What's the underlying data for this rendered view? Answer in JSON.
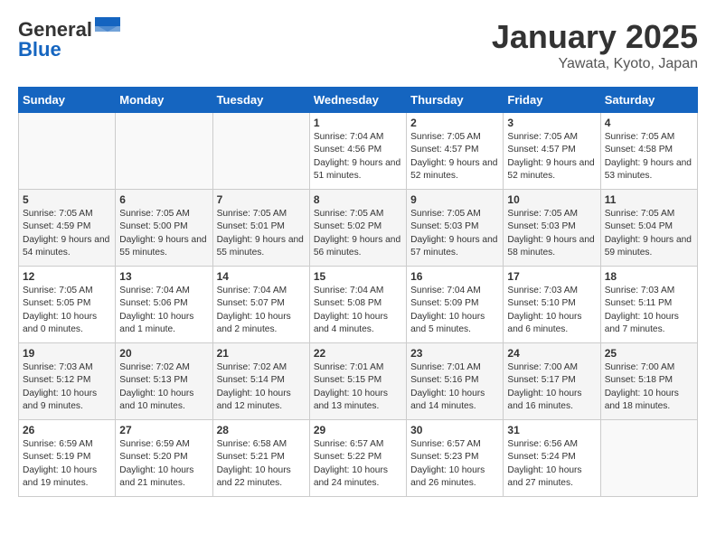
{
  "header": {
    "logo_general": "General",
    "logo_blue": "Blue",
    "month_year": "January 2025",
    "location": "Yawata, Kyoto, Japan"
  },
  "weekdays": [
    "Sunday",
    "Monday",
    "Tuesday",
    "Wednesday",
    "Thursday",
    "Friday",
    "Saturday"
  ],
  "weeks": [
    [
      {
        "day": "",
        "content": ""
      },
      {
        "day": "",
        "content": ""
      },
      {
        "day": "",
        "content": ""
      },
      {
        "day": "1",
        "content": "Sunrise: 7:04 AM\nSunset: 4:56 PM\nDaylight: 9 hours and 51 minutes."
      },
      {
        "day": "2",
        "content": "Sunrise: 7:05 AM\nSunset: 4:57 PM\nDaylight: 9 hours and 52 minutes."
      },
      {
        "day": "3",
        "content": "Sunrise: 7:05 AM\nSunset: 4:57 PM\nDaylight: 9 hours and 52 minutes."
      },
      {
        "day": "4",
        "content": "Sunrise: 7:05 AM\nSunset: 4:58 PM\nDaylight: 9 hours and 53 minutes."
      }
    ],
    [
      {
        "day": "5",
        "content": "Sunrise: 7:05 AM\nSunset: 4:59 PM\nDaylight: 9 hours and 54 minutes."
      },
      {
        "day": "6",
        "content": "Sunrise: 7:05 AM\nSunset: 5:00 PM\nDaylight: 9 hours and 55 minutes."
      },
      {
        "day": "7",
        "content": "Sunrise: 7:05 AM\nSunset: 5:01 PM\nDaylight: 9 hours and 55 minutes."
      },
      {
        "day": "8",
        "content": "Sunrise: 7:05 AM\nSunset: 5:02 PM\nDaylight: 9 hours and 56 minutes."
      },
      {
        "day": "9",
        "content": "Sunrise: 7:05 AM\nSunset: 5:03 PM\nDaylight: 9 hours and 57 minutes."
      },
      {
        "day": "10",
        "content": "Sunrise: 7:05 AM\nSunset: 5:03 PM\nDaylight: 9 hours and 58 minutes."
      },
      {
        "day": "11",
        "content": "Sunrise: 7:05 AM\nSunset: 5:04 PM\nDaylight: 9 hours and 59 minutes."
      }
    ],
    [
      {
        "day": "12",
        "content": "Sunrise: 7:05 AM\nSunset: 5:05 PM\nDaylight: 10 hours and 0 minutes."
      },
      {
        "day": "13",
        "content": "Sunrise: 7:04 AM\nSunset: 5:06 PM\nDaylight: 10 hours and 1 minute."
      },
      {
        "day": "14",
        "content": "Sunrise: 7:04 AM\nSunset: 5:07 PM\nDaylight: 10 hours and 2 minutes."
      },
      {
        "day": "15",
        "content": "Sunrise: 7:04 AM\nSunset: 5:08 PM\nDaylight: 10 hours and 4 minutes."
      },
      {
        "day": "16",
        "content": "Sunrise: 7:04 AM\nSunset: 5:09 PM\nDaylight: 10 hours and 5 minutes."
      },
      {
        "day": "17",
        "content": "Sunrise: 7:03 AM\nSunset: 5:10 PM\nDaylight: 10 hours and 6 minutes."
      },
      {
        "day": "18",
        "content": "Sunrise: 7:03 AM\nSunset: 5:11 PM\nDaylight: 10 hours and 7 minutes."
      }
    ],
    [
      {
        "day": "19",
        "content": "Sunrise: 7:03 AM\nSunset: 5:12 PM\nDaylight: 10 hours and 9 minutes."
      },
      {
        "day": "20",
        "content": "Sunrise: 7:02 AM\nSunset: 5:13 PM\nDaylight: 10 hours and 10 minutes."
      },
      {
        "day": "21",
        "content": "Sunrise: 7:02 AM\nSunset: 5:14 PM\nDaylight: 10 hours and 12 minutes."
      },
      {
        "day": "22",
        "content": "Sunrise: 7:01 AM\nSunset: 5:15 PM\nDaylight: 10 hours and 13 minutes."
      },
      {
        "day": "23",
        "content": "Sunrise: 7:01 AM\nSunset: 5:16 PM\nDaylight: 10 hours and 14 minutes."
      },
      {
        "day": "24",
        "content": "Sunrise: 7:00 AM\nSunset: 5:17 PM\nDaylight: 10 hours and 16 minutes."
      },
      {
        "day": "25",
        "content": "Sunrise: 7:00 AM\nSunset: 5:18 PM\nDaylight: 10 hours and 18 minutes."
      }
    ],
    [
      {
        "day": "26",
        "content": "Sunrise: 6:59 AM\nSunset: 5:19 PM\nDaylight: 10 hours and 19 minutes."
      },
      {
        "day": "27",
        "content": "Sunrise: 6:59 AM\nSunset: 5:20 PM\nDaylight: 10 hours and 21 minutes."
      },
      {
        "day": "28",
        "content": "Sunrise: 6:58 AM\nSunset: 5:21 PM\nDaylight: 10 hours and 22 minutes."
      },
      {
        "day": "29",
        "content": "Sunrise: 6:57 AM\nSunset: 5:22 PM\nDaylight: 10 hours and 24 minutes."
      },
      {
        "day": "30",
        "content": "Sunrise: 6:57 AM\nSunset: 5:23 PM\nDaylight: 10 hours and 26 minutes."
      },
      {
        "day": "31",
        "content": "Sunrise: 6:56 AM\nSunset: 5:24 PM\nDaylight: 10 hours and 27 minutes."
      },
      {
        "day": "",
        "content": ""
      }
    ]
  ]
}
